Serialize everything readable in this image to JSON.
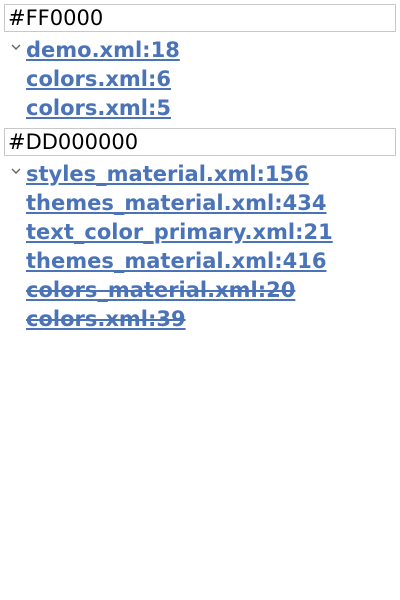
{
  "groups": [
    {
      "value": "#FF0000",
      "references": [
        {
          "label": "demo.xml:18"
        },
        {
          "label": "colors.xml:6"
        },
        {
          "label": "colors.xml:5"
        }
      ]
    },
    {
      "value": "#DD000000",
      "references": [
        {
          "label": "styles_material.xml:156"
        },
        {
          "label": "themes_material.xml:434"
        },
        {
          "label": "text_color_primary.xml:21"
        },
        {
          "label": "themes_material.xml:416"
        },
        {
          "label": "colors_material.xml:20"
        },
        {
          "label": "colors.xml:39"
        }
      ]
    }
  ],
  "icons": {
    "expander": "chevron-down-icon"
  },
  "colors": {
    "link": "#4a73b8",
    "text": "#000000",
    "border": "#c8c8c8"
  }
}
